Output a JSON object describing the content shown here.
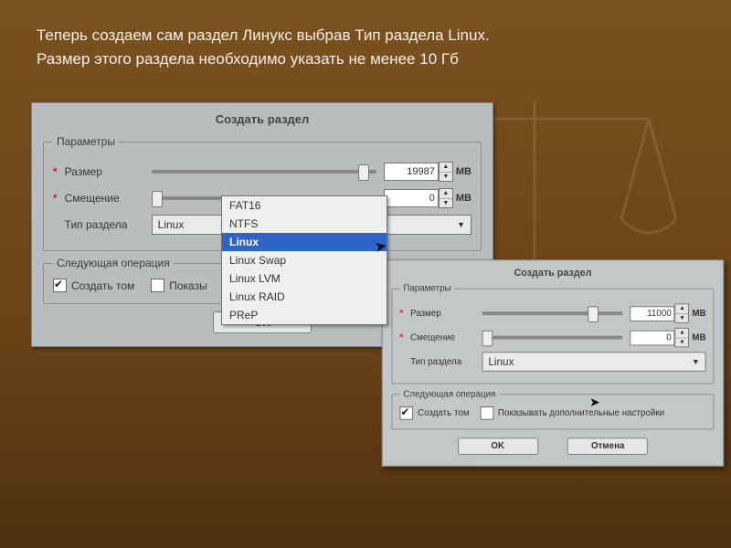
{
  "instruction": {
    "line1": "Теперь создаем сам раздел Линукс выбрав Тип раздела Linux.",
    "line2": "Размер этого раздела необходимо указать не менее 10 Гб"
  },
  "dialog1": {
    "title": "Создать раздел",
    "params_legend": "Параметры",
    "size_label": "Размер",
    "size_value": "19987",
    "size_unit": "MB",
    "offset_label": "Смещение",
    "offset_value": "0",
    "offset_unit": "MB",
    "type_label": "Тип раздела",
    "type_value": "Linux",
    "next_legend": "Следующая операция",
    "create_volume": "Создать том",
    "show_more": "Показы",
    "ok": "OK",
    "dropdown": [
      "FAT16",
      "NTFS",
      "Linux",
      "Linux Swap",
      "Linux LVM",
      "Linux RAID",
      "PReP"
    ],
    "dropdown_selected": "Linux"
  },
  "dialog2": {
    "title": "Создать раздел",
    "params_legend": "Параметры",
    "size_label": "Размер",
    "size_value": "11000",
    "size_unit": "MB",
    "offset_label": "Смещение",
    "offset_value": "0",
    "offset_unit": "MB",
    "type_label": "Тип раздела",
    "type_value": "Linux",
    "next_legend": "Следующая операция",
    "create_volume": "Создать том",
    "show_more": "Показывать дополнительные настройки",
    "ok": "OK",
    "cancel": "Отмена"
  }
}
